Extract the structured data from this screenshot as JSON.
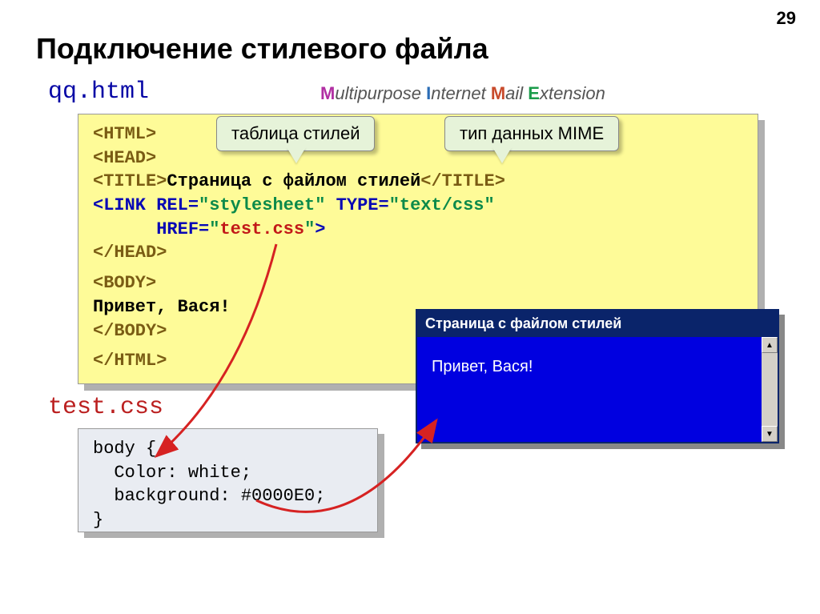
{
  "page_number": "29",
  "heading": "Подключение стилевого файла",
  "filename_html": "qq.html",
  "filename_css": "test.css",
  "mime": {
    "M": "M",
    "ultipurpose": "ultipurpose ",
    "I": "I",
    "nternet": "nternet ",
    "Ma": "M",
    "ail": "ail ",
    "E": "E",
    "xtension": "xtension"
  },
  "callout1": "таблица стилей",
  "callout2": "тип данных MIME",
  "code_html": {
    "l1": "<HTML>",
    "l2": "<HEAD>",
    "l3a": "<TITLE>",
    "l3b": "Страница с файлом стилей",
    "l3c": "</TITLE>",
    "l4a": "<LINK REL=",
    "l4b": "\"stylesheet\"",
    "l4c": " TYPE=",
    "l4d": "\"text/css\"",
    "l5a": "      HREF=",
    "l5b": "\"",
    "l5c": "test.css",
    "l5d": "\"",
    "l5e": ">",
    "l6": "</HEAD>",
    "l7": "<BODY>",
    "l8": "Привет, Вася!",
    "l9": "</BODY>",
    "l10": "</HTML>"
  },
  "code_css": {
    "l1": "body {",
    "l2": "  Color: white;",
    "l3": "  background: #0000E0;",
    "l4": "}"
  },
  "browser": {
    "title": "Страница с файлом стилей",
    "content": "Привет, Вася!"
  }
}
